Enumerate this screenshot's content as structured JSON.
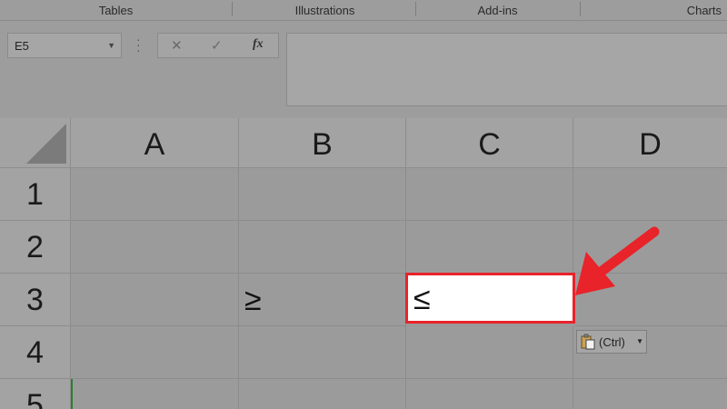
{
  "ribbon": {
    "groups": [
      "Tables",
      "Illustrations",
      "Add-ins",
      "Charts"
    ]
  },
  "formula_bar": {
    "name_box": "E5",
    "cancel_icon": "✕",
    "enter_icon": "✓",
    "fx_label": "fx",
    "formula": ""
  },
  "columns": [
    "A",
    "B",
    "C",
    "D"
  ],
  "rows": [
    "1",
    "2",
    "3",
    "4",
    "5"
  ],
  "cells": {
    "B3": "≥",
    "C3": "≤"
  },
  "paste_options": {
    "label": "(Ctrl)",
    "icon": "clipboard-icon"
  },
  "colors": {
    "selection_border": "#e8232a",
    "arrow": "#e8232a"
  }
}
